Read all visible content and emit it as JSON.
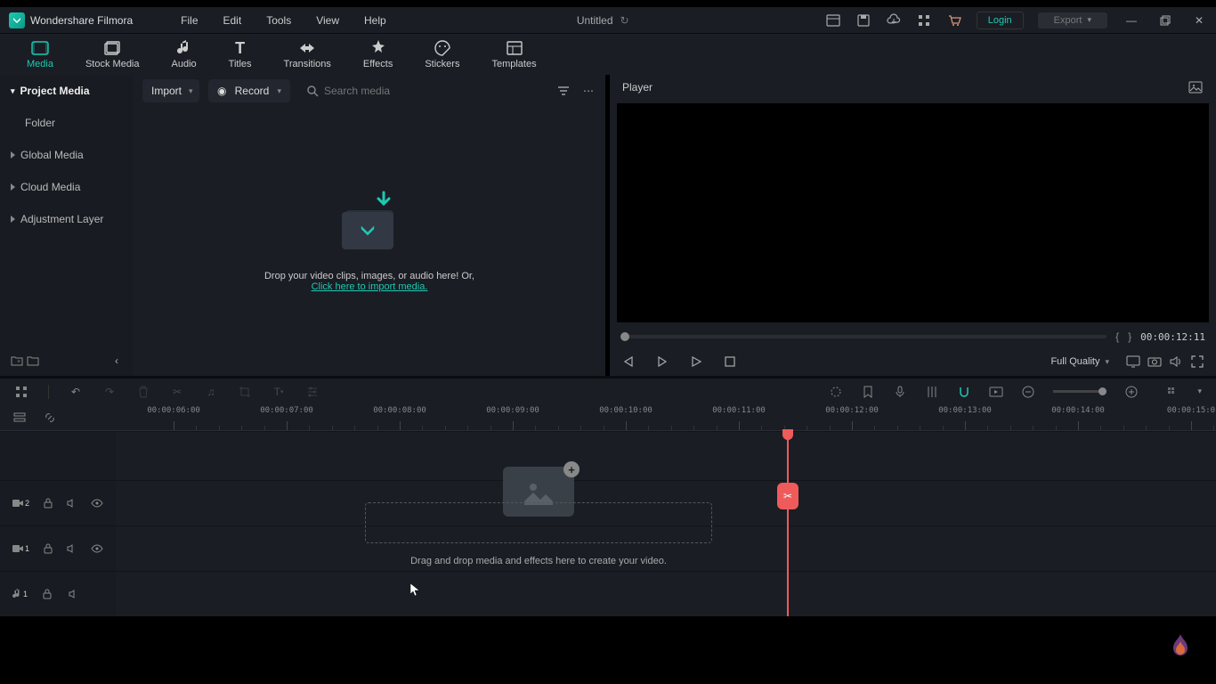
{
  "app": {
    "name": "Wondershare Filmora",
    "doc": "Untitled"
  },
  "menu": [
    "File",
    "Edit",
    "Tools",
    "View",
    "Help"
  ],
  "win": {
    "login": "Login",
    "export": "Export"
  },
  "ribbon": [
    {
      "label": "Media",
      "active": true
    },
    {
      "label": "Stock Media"
    },
    {
      "label": "Audio"
    },
    {
      "label": "Titles"
    },
    {
      "label": "Transitions"
    },
    {
      "label": "Effects"
    },
    {
      "label": "Stickers"
    },
    {
      "label": "Templates"
    }
  ],
  "side": {
    "project": "Project Media",
    "folder": "Folder",
    "global": "Global Media",
    "cloud": "Cloud Media",
    "adjust": "Adjustment Layer"
  },
  "browser": {
    "import": "Import",
    "record": "Record",
    "search_placeholder": "Search media",
    "drop": "Drop your video clips, images, or audio here! Or,",
    "link": "Click here to import media."
  },
  "player": {
    "title": "Player",
    "brace_l": "{",
    "brace_r": "}",
    "time": "00:00:12:11",
    "quality": "Full Quality"
  },
  "ruler": [
    "00:00:06:00",
    "00:00:07:00",
    "00:00:08:00",
    "00:00:09:00",
    "00:00:10:00",
    "00:00:11:00",
    "00:00:12:00",
    "00:00:13:00",
    "00:00:14:00",
    "00:00:15:0"
  ],
  "timeline": {
    "hint": "Drag and drop media and effects here to create your video."
  },
  "tracks": {
    "v2": "2",
    "v1": "1",
    "a1": "1"
  }
}
